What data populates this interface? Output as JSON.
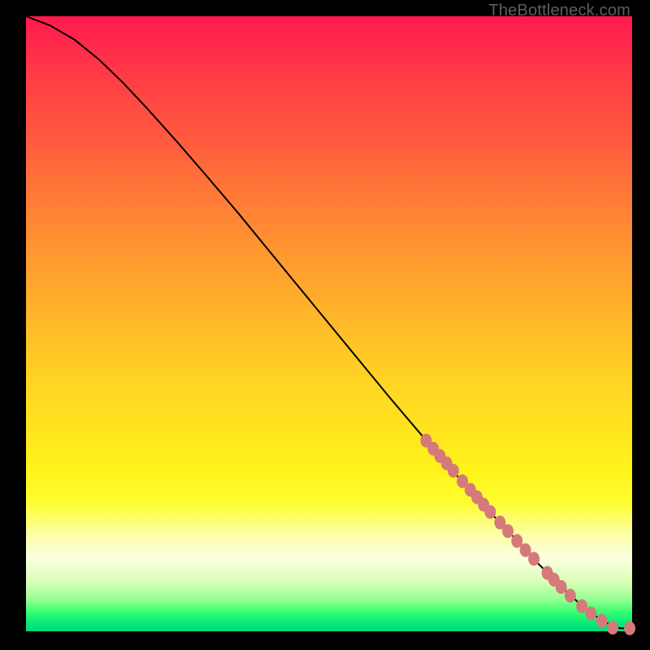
{
  "watermark": "TheBottleneck.com",
  "colors": {
    "curve": "#000000",
    "marker_fill": "#d57a7a",
    "marker_stroke": "#9c4a4a"
  },
  "chart_data": {
    "type": "line",
    "title": "",
    "xlabel": "",
    "ylabel": "",
    "xlim": [
      0,
      100
    ],
    "ylim": [
      0,
      100
    ],
    "grid": false,
    "legend": false,
    "series": [
      {
        "name": "curve",
        "x": [
          0,
          4,
          8,
          12,
          16,
          20,
          25,
          30,
          35,
          40,
          45,
          50,
          55,
          60,
          65,
          70,
          75,
          80,
          84,
          88,
          91,
          93,
          95,
          96.5,
          98,
          100
        ],
        "y": [
          100,
          98.5,
          96.2,
          93.0,
          89.2,
          85.0,
          79.5,
          73.8,
          68.0,
          62.0,
          56.0,
          50.0,
          44.0,
          38.0,
          32.2,
          26.5,
          21.0,
          15.8,
          11.5,
          7.6,
          4.8,
          3.2,
          1.8,
          1.0,
          0.5,
          0.5
        ]
      }
    ],
    "markers": [
      {
        "x": 66.0,
        "y": 31.0
      },
      {
        "x": 67.2,
        "y": 29.7
      },
      {
        "x": 68.3,
        "y": 28.5
      },
      {
        "x": 69.4,
        "y": 27.3
      },
      {
        "x": 70.5,
        "y": 26.1
      },
      {
        "x": 72.0,
        "y": 24.4
      },
      {
        "x": 73.3,
        "y": 23.0
      },
      {
        "x": 74.4,
        "y": 21.8
      },
      {
        "x": 75.5,
        "y": 20.6
      },
      {
        "x": 76.6,
        "y": 19.4
      },
      {
        "x": 78.2,
        "y": 17.7
      },
      {
        "x": 79.5,
        "y": 16.3
      },
      {
        "x": 81.0,
        "y": 14.7
      },
      {
        "x": 82.4,
        "y": 13.2
      },
      {
        "x": 83.8,
        "y": 11.8
      },
      {
        "x": 86.0,
        "y": 9.5
      },
      {
        "x": 87.1,
        "y": 8.4
      },
      {
        "x": 88.3,
        "y": 7.2
      },
      {
        "x": 89.8,
        "y": 5.8
      },
      {
        "x": 91.7,
        "y": 4.1
      },
      {
        "x": 93.2,
        "y": 2.9
      },
      {
        "x": 95.0,
        "y": 1.7
      },
      {
        "x": 96.8,
        "y": 0.6
      },
      {
        "x": 99.6,
        "y": 0.5
      }
    ]
  }
}
